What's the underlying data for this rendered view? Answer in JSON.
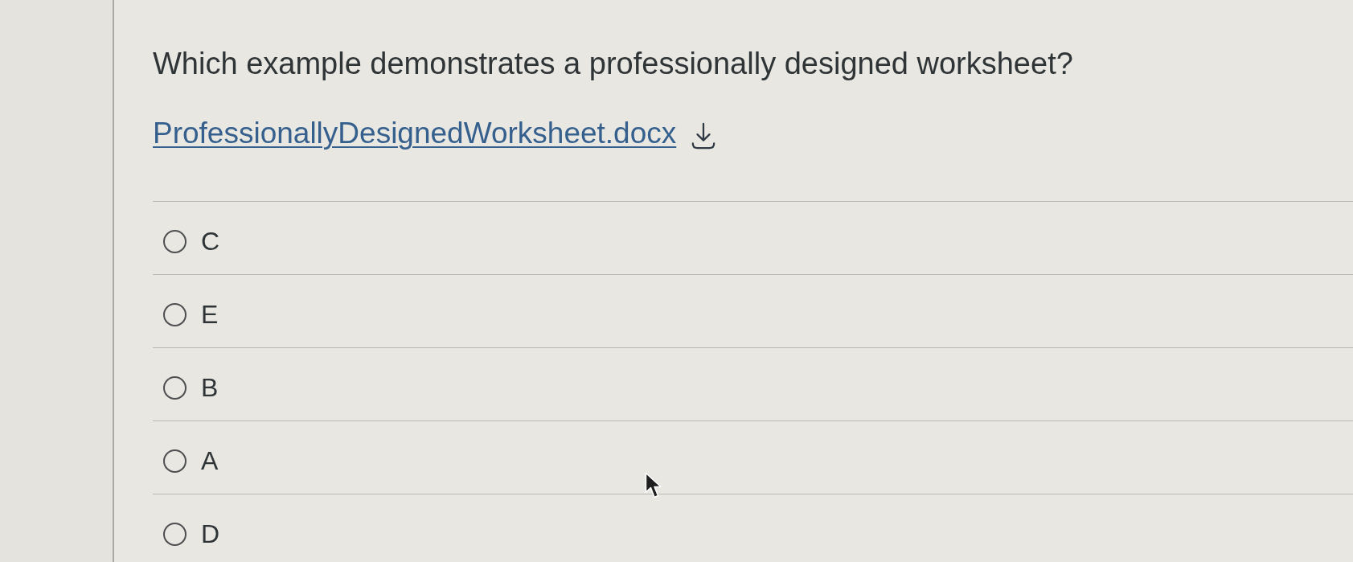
{
  "question": {
    "text": "Which example demonstrates a professionally designed worksheet?"
  },
  "attachment": {
    "filename": "ProfessionallyDesignedWorksheet.docx"
  },
  "options": [
    {
      "label": "C",
      "selected": false
    },
    {
      "label": "E",
      "selected": false
    },
    {
      "label": "B",
      "selected": false
    },
    {
      "label": "A",
      "selected": false
    },
    {
      "label": "D",
      "selected": false
    }
  ]
}
